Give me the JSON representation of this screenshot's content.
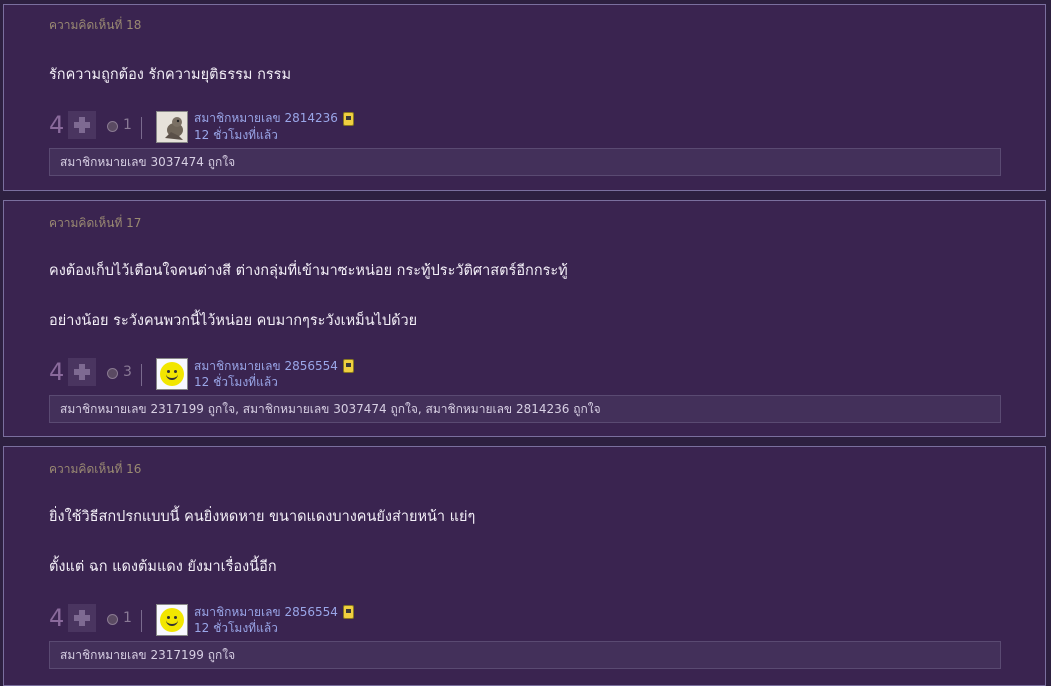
{
  "comments": [
    {
      "label": "ความคิดเห็นที่ 18",
      "lines": [
        "รักความถูกต้อง   รักความยุติธรรม    กรรม"
      ],
      "votes": "4",
      "emotion_count": "1",
      "user": "สมาชิกหมายเลข 2814236",
      "time": "12 ชั่วโมงที่แล้ว",
      "avatar": "photo-avatar",
      "likes": "สมาชิกหมายเลข 3037474 ถูกใจ"
    },
    {
      "label": "ความคิดเห็นที่ 17",
      "lines": [
        "คงต้องเก็บไว้เตือนใจคนต่างสี ต่างกลุ่มที่เข้ามาซะหน่อย  กระทู้ประวัติศาสตร์อีกกระทู้",
        "อย่างน้อย ระวังคนพวกนี้ไว้หน่อย คบมากๆระวังเหม็นไปด้วย"
      ],
      "votes": "4",
      "emotion_count": "3",
      "user": "สมาชิกหมายเลข 2856554",
      "time": "12 ชั่วโมงที่แล้ว",
      "avatar": "smiley-avatar",
      "likes": "สมาชิกหมายเลข 2317199 ถูกใจ, สมาชิกหมายเลข 3037474 ถูกใจ, สมาชิกหมายเลข 2814236 ถูกใจ"
    },
    {
      "label": "ความคิดเห็นที่ 16",
      "lines": [
        "ยิ่งใช้วิธีสกปรกแบบนี้ คนยิ่งหดหาย ขนาดแดงบางคนยังส่ายหน้า  แย่ๆ",
        "ตั้งแต่ ฉก แดงต้มแดง  ยังมาเรื่องนี้อีก"
      ],
      "votes": "4",
      "emotion_count": "1",
      "user": "สมาชิกหมายเลข 2856554",
      "time": "12 ชั่วโมงที่แล้ว",
      "avatar": "smiley-avatar",
      "likes": "สมาชิกหมายเลข 2317199 ถูกใจ"
    }
  ],
  "colors": {
    "background": "#2d2040",
    "card": "#3a2450",
    "username": "#9aa6e8",
    "label": "#9a8a72"
  }
}
